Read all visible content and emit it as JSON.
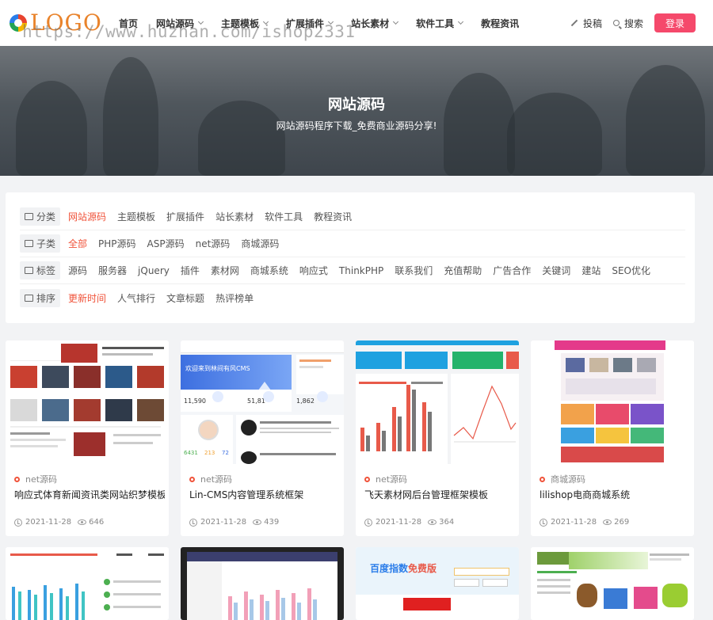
{
  "logo": {
    "text": "LOGO",
    "watermark": "https://www.huzhan.com/ishop2331"
  },
  "nav": {
    "items": [
      {
        "label": "首页",
        "dropdown": false
      },
      {
        "label": "网站源码",
        "dropdown": true
      },
      {
        "label": "主题模板",
        "dropdown": true
      },
      {
        "label": "扩展插件",
        "dropdown": true
      },
      {
        "label": "站长素材",
        "dropdown": true
      },
      {
        "label": "软件工具",
        "dropdown": true
      },
      {
        "label": "教程资讯",
        "dropdown": false
      }
    ],
    "submit_label": "投稿",
    "search_label": "搜索",
    "login_label": "登录"
  },
  "banner": {
    "title": "网站源码",
    "subtitle": "网站源码程序下载_免费商业源码分享!"
  },
  "filters": {
    "category": {
      "label": "分类",
      "items": [
        "网站源码",
        "主题模板",
        "扩展插件",
        "站长素材",
        "软件工具",
        "教程资讯"
      ],
      "active": 0
    },
    "subcategory": {
      "label": "子类",
      "items": [
        "全部",
        "PHP源码",
        "ASP源码",
        "net源码",
        "商城源码"
      ],
      "active": 0
    },
    "tags": {
      "label": "标签",
      "items": [
        "源码",
        "服务器",
        "jQuery",
        "插件",
        "素材网",
        "商城系统",
        "响应式",
        "ThinkPHP",
        "联系我们",
        "充值帮助",
        "广告合作",
        "关键词",
        "建站",
        "SEO优化"
      ],
      "active": -1
    },
    "sort": {
      "label": "排序",
      "items": [
        "更新时间",
        "人气排行",
        "文章标题",
        "热评榜单"
      ],
      "active": 0
    }
  },
  "cards": [
    {
      "category": "net源码",
      "title": "响应式体育新闻资讯类网站织梦模板",
      "date": "2021-11-28",
      "views": "646"
    },
    {
      "category": "net源码",
      "title": "Lin-CMS内容管理系统框架",
      "date": "2021-11-28",
      "views": "439"
    },
    {
      "category": "net源码",
      "title": "飞天素材网后台管理框架模板",
      "date": "2021-11-28",
      "views": "364"
    },
    {
      "category": "商城源码",
      "title": "lilishop电商商城系统",
      "date": "2021-11-28",
      "views": "269"
    }
  ],
  "thumbs": {
    "cms": {
      "welcome": "欢迎来到林间有风CMS",
      "stats": [
        "11,590",
        "51,81",
        "1,862"
      ],
      "small": [
        "6431",
        "213",
        "72"
      ]
    },
    "baidu": {
      "brand": "百度指数",
      "free": "免费版"
    }
  },
  "colors": {
    "accent": "#f0533a",
    "login": "#f5496b"
  }
}
